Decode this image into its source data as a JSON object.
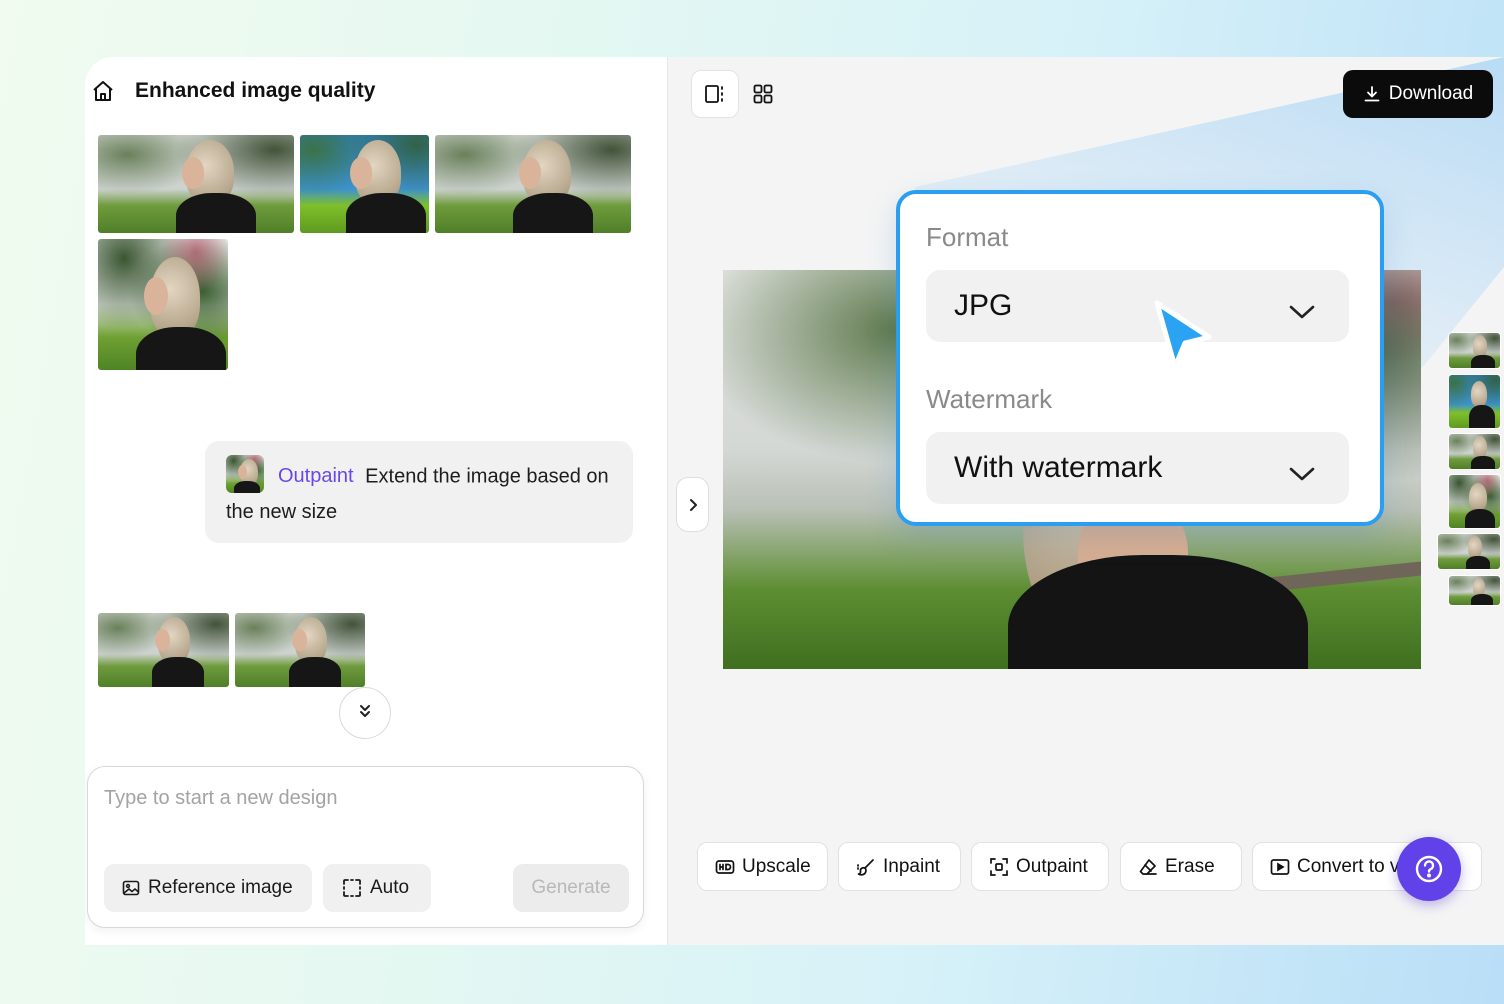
{
  "header": {
    "title": "Enhanced image quality",
    "home_icon": "home-icon"
  },
  "chat": {
    "message": {
      "tag": "Outpaint",
      "text": "Extend the image based on the new size"
    }
  },
  "composer": {
    "placeholder": "Type to start a new design",
    "reference_label": "Reference image",
    "auto_label": "Auto",
    "generate_label": "Generate"
  },
  "toolbar": {
    "download_label": "Download"
  },
  "export_popup": {
    "format_label": "Format",
    "format_value": "JPG",
    "watermark_label": "Watermark",
    "watermark_value": "With watermark"
  },
  "tools": [
    {
      "label": "Upscale",
      "icon": "hd-icon"
    },
    {
      "label": "Inpaint",
      "icon": "brush-icon"
    },
    {
      "label": "Outpaint",
      "icon": "expand-icon"
    },
    {
      "label": "Erase",
      "icon": "eraser-icon"
    },
    {
      "label": "Convert to v",
      "icon": "video-icon"
    }
  ],
  "colors": {
    "accent_purple": "#6042e8",
    "popup_border": "#2a9ef0",
    "cursor_blue": "#2ba3f3",
    "tag_purple": "#6a48e8"
  }
}
